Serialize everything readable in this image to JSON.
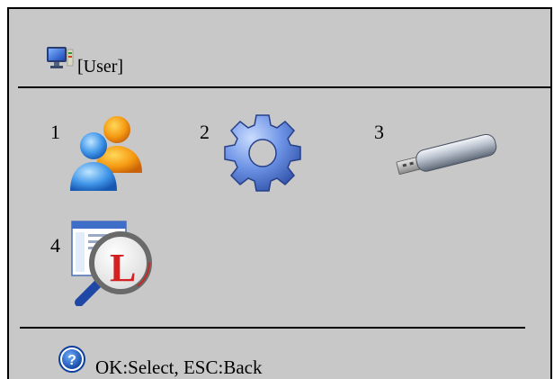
{
  "header": {
    "title": "[User]",
    "icon": "user-monitor-icon"
  },
  "menu": {
    "items": [
      {
        "number": "1",
        "icon": "users-icon"
      },
      {
        "number": "2",
        "icon": "gear-icon"
      },
      {
        "number": "3",
        "icon": "usb-drive-icon"
      },
      {
        "number": "4",
        "icon": "log-search-icon"
      }
    ]
  },
  "footer": {
    "help_icon": "help-icon",
    "hint": "OK:Select, ESC:Back"
  },
  "colors": {
    "background": "#c8c8c8",
    "border": "#000000"
  }
}
